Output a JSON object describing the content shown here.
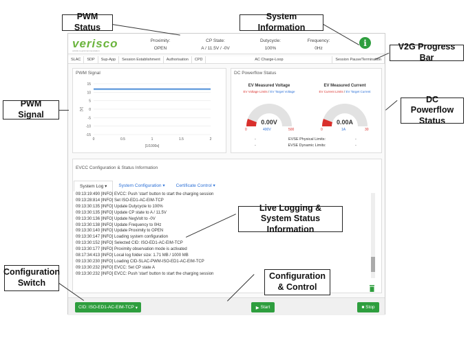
{
  "callouts": {
    "pwm_status": "PWM Status",
    "system_information": "System Information",
    "v2g_progress_bar": "V2G Progress Bar",
    "pwm_signal": "PWM Signal",
    "dc_powerflow_status": "DC Powerflow Status",
    "live_logging": "Live Logging & System Status Information",
    "configuration_switch": "Configuration Switch",
    "configuration_control": "Configuration & Control"
  },
  "header": {
    "logo": "verisco",
    "logo_tagline": "vehicle to grid communication",
    "proximity_label": "Proximity:",
    "proximity_value": "OPEN",
    "cp_state_label": "CP State:",
    "cp_state_value": "A / 11.5V / -0V",
    "dutycycle_label": "Dutycycle:",
    "dutycycle_value": "100%",
    "frequency_label": "Frequency:",
    "frequency_value": "0Hz",
    "info_icon_glyph": "i"
  },
  "progress_bar": [
    "SLAC",
    "SDP",
    "Sup-App",
    "Session Establishment",
    "Authorisation",
    "CPD",
    "AC Charge-Loop",
    "Session Pause/Termination"
  ],
  "pwm_panel": {
    "title": "PWM Signal",
    "ylabel": "[V]",
    "xlabel": "[1/1000s]"
  },
  "chart_data": {
    "type": "line",
    "series": [
      {
        "x": [
          0,
          2
        ],
        "y": [
          11.5,
          11.5
        ],
        "color": "#7eb6e8"
      },
      {
        "x": [
          0,
          2
        ],
        "y": [
          12,
          12
        ],
        "color": "#1a66c8"
      }
    ],
    "xlabel": "[1/1000s]",
    "ylabel": "[V]",
    "xlim": [
      0,
      2
    ],
    "ylim": [
      -15,
      15
    ],
    "xticks": [
      "0",
      "0.5",
      "1",
      "1.5",
      "2"
    ],
    "yticks": [
      "15",
      "10",
      "5",
      "0",
      "-5",
      "-10",
      "-15"
    ],
    "grid": true
  },
  "dc_panel": {
    "title": "DC Powerflow Status",
    "voltage_title": "EV Measured Voltage",
    "voltage_limits": "EV Voltage Limits",
    "voltage_target": "EV Target Voltage",
    "voltage_value": "0.00V",
    "voltage_min": "0",
    "voltage_mid": "400V",
    "voltage_max": "500",
    "current_title": "EV Measured Current",
    "current_limits": "EV Current Limits",
    "current_target": "EV Target Current",
    "current_value": "0.00A",
    "current_min": "0",
    "current_mid": "1A",
    "current_max": "30",
    "physical_label": "EVSE Physical Limits:",
    "dynamic_label": "EVSE Dynamic Limits:",
    "dash": "-"
  },
  "evcc_panel": {
    "title": "EVCC Configuration & Status Information",
    "tabs": [
      "System Log",
      "System Configuration",
      "Certificate Control"
    ],
    "log": [
      "09:13:19:490 [INFO] EVCC: Push 'start' button to start the charging session",
      "09:13:28:814 [INFO] Set ISO-ED1-AC-EIM-TCP",
      "09:13:30:135 [INFO] Update Dutycycle to 100%",
      "09:13:30:135 [INFO] Update CP state to A / 11.5V",
      "09:13:30:136 [INFO] Update NegVolt to -0V",
      "09:13:30:138 [INFO] Update Frequency to 0Hz",
      "09:13:30:140 [INFO] Update Proximity to OPEN",
      "09:13:30:147 [INFO] Loading system configuration",
      "09:13:30:152 [INFO] Selected CID: ISO-ED1-AC-EIM-TCP",
      "09:13:30:177 [INFO] Proximity observation mode is activated",
      "08:17:34:413 [INFO] Local log folder size: 1.71 MB / 1000 MB",
      "09:13:30:230 [INFO] Loading CID-SLAC-PWM-ISO-ED1-AC-EIM-TCP",
      "09:13:30:232 [INFO] EVCC: Set CP state A",
      "09:13:30:232 [INFO] EVCC: Push 'start' button to start the charging session"
    ]
  },
  "footer": {
    "cid_button": "CID: ISO-ED1-AC-EIM-TCP",
    "start_button": "Start",
    "stop_button": "Stop"
  },
  "colors": {
    "green": "#2e9e3e",
    "red": "#d9302c",
    "blue": "#2a6fd6"
  }
}
